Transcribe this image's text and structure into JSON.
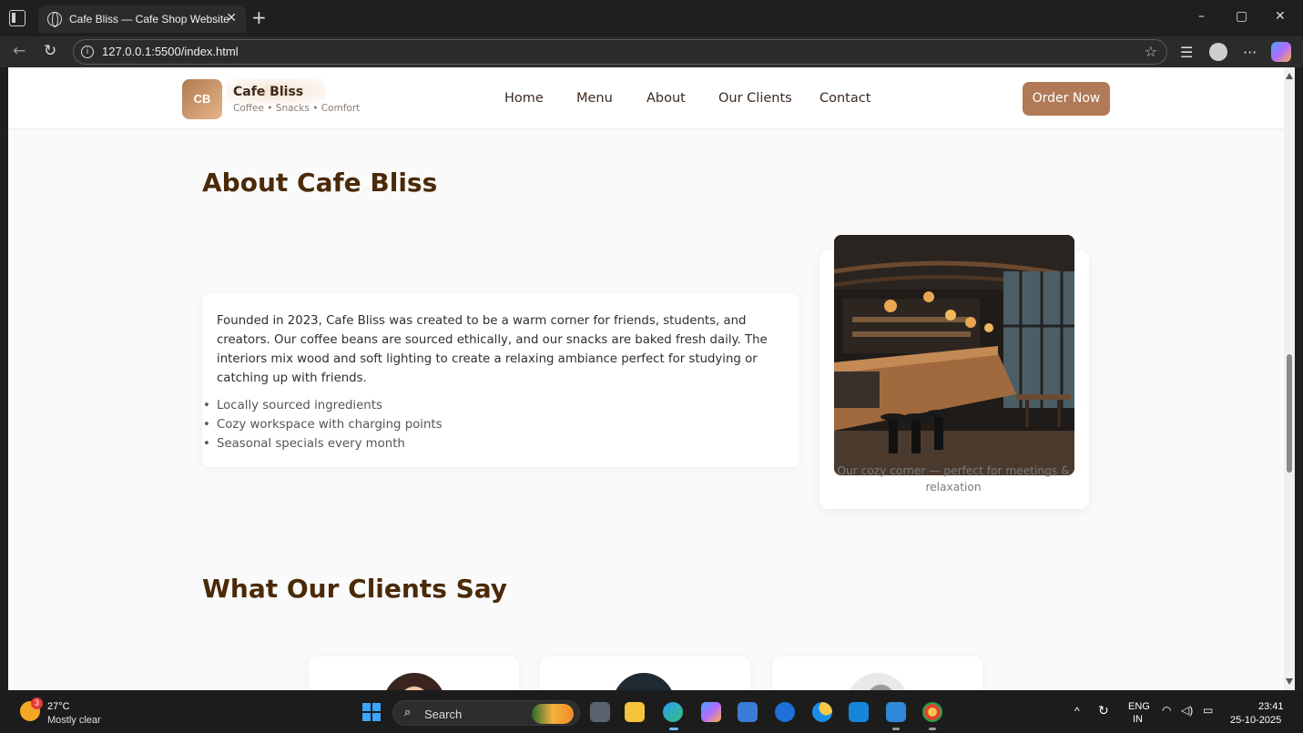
{
  "browser": {
    "tab_title": "Cafe Bliss — Cafe Shop Website",
    "tab_close": "✕",
    "new_tab": "+",
    "url": "127.0.0.1:5500/index.html",
    "window_controls": {
      "minimize": "–",
      "maximize": "▢",
      "close": "✕"
    }
  },
  "site": {
    "logo_initials": "CB",
    "brand_name": "Cafe Bliss",
    "brand_tagline": "Coffee • Snacks • Comfort",
    "nav": [
      "Home",
      "Menu",
      "About",
      "Our Clients",
      "Contact"
    ],
    "cta_label": "Order Now",
    "accent_color": "#b07a57",
    "heading_color": "#4a2a08"
  },
  "about": {
    "heading": "About Cafe Bliss",
    "paragraph": "Founded in 2023, Cafe Bliss was created to be a warm corner for friends, students, and creators. Our coffee beans are sourced ethically, and our snacks are baked fresh daily. The interiors mix wood and soft lighting to create a relaxing ambiance perfect for studying or catching up with friends.",
    "features": [
      "Locally sourced ingredients",
      "Cozy workspace with charging points",
      "Seasonal specials every month"
    ],
    "image_caption": "Our cozy corner — perfect for meetings & relaxation"
  },
  "clients": {
    "heading": "What Our Clients Say"
  },
  "taskbar": {
    "weather_temp": "27°C",
    "weather_desc": "Mostly clear",
    "weather_badge": "3",
    "search_label": "Search",
    "lang_top": "ENG",
    "lang_bottom": "IN",
    "time": "23:41",
    "date": "25-10-2025"
  }
}
